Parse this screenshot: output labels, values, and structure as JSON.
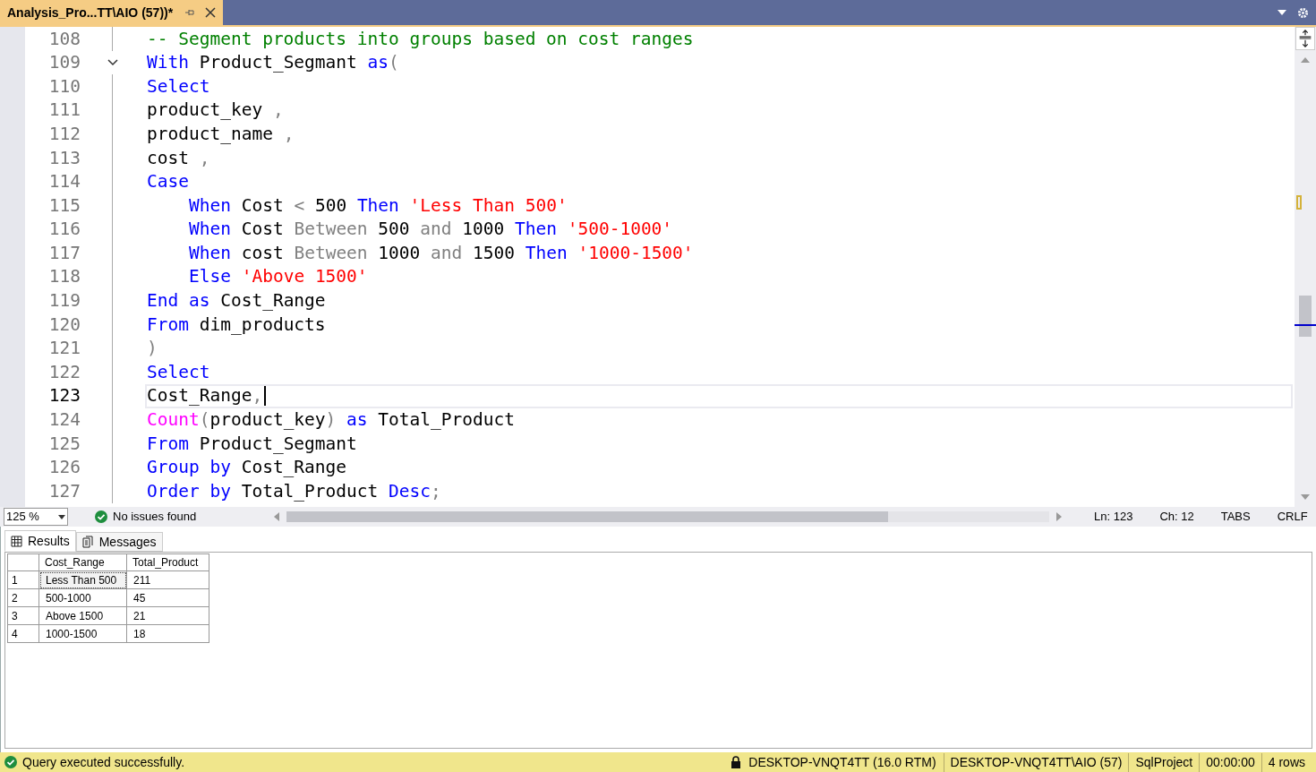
{
  "tab": {
    "title": "Analysis_Pro...TT\\AIO (57))*",
    "selected": true
  },
  "editor": {
    "lines": [
      {
        "number": "108",
        "current": false,
        "foldable": false,
        "indented": false,
        "tokens": [
          {
            "kind": "comment",
            "text": "-- Segment products into groups based on cost ranges"
          }
        ]
      },
      {
        "number": "109",
        "current": false,
        "foldable": true,
        "indented": false,
        "tokens": [
          {
            "kind": "keyword",
            "text": "With"
          },
          {
            "kind": "plain",
            "text": " Product_Segmant "
          },
          {
            "kind": "keyword",
            "text": "as"
          },
          {
            "kind": "gray",
            "text": "("
          }
        ]
      },
      {
        "number": "110",
        "current": false,
        "foldable": false,
        "indented": false,
        "tokens": [
          {
            "kind": "keyword",
            "text": "Select"
          }
        ]
      },
      {
        "number": "111",
        "current": false,
        "foldable": false,
        "indented": false,
        "tokens": [
          {
            "kind": "plain",
            "text": "product_key "
          },
          {
            "kind": "gray",
            "text": ","
          }
        ]
      },
      {
        "number": "112",
        "current": false,
        "foldable": false,
        "indented": false,
        "tokens": [
          {
            "kind": "plain",
            "text": "product_name "
          },
          {
            "kind": "gray",
            "text": ","
          }
        ]
      },
      {
        "number": "113",
        "current": false,
        "foldable": false,
        "indented": false,
        "tokens": [
          {
            "kind": "plain",
            "text": "cost "
          },
          {
            "kind": "gray",
            "text": ","
          }
        ]
      },
      {
        "number": "114",
        "current": false,
        "foldable": false,
        "indented": false,
        "tokens": [
          {
            "kind": "keyword",
            "text": "Case"
          }
        ]
      },
      {
        "number": "115",
        "current": false,
        "foldable": false,
        "indented": true,
        "tokens": [
          {
            "kind": "keyword",
            "text": "When"
          },
          {
            "kind": "plain",
            "text": " Cost "
          },
          {
            "kind": "gray",
            "text": "<"
          },
          {
            "kind": "plain",
            "text": " 500 "
          },
          {
            "kind": "keyword",
            "text": "Then "
          },
          {
            "kind": "string",
            "text": "'Less Than 500'"
          }
        ]
      },
      {
        "number": "116",
        "current": false,
        "foldable": false,
        "indented": true,
        "tokens": [
          {
            "kind": "keyword",
            "text": "When"
          },
          {
            "kind": "plain",
            "text": " Cost "
          },
          {
            "kind": "gray",
            "text": "Between"
          },
          {
            "kind": "plain",
            "text": " 500 "
          },
          {
            "kind": "gray",
            "text": "and"
          },
          {
            "kind": "plain",
            "text": " 1000 "
          },
          {
            "kind": "keyword",
            "text": "Then "
          },
          {
            "kind": "string",
            "text": "'500-1000'"
          }
        ]
      },
      {
        "number": "117",
        "current": false,
        "foldable": false,
        "indented": true,
        "tokens": [
          {
            "kind": "keyword",
            "text": "When"
          },
          {
            "kind": "plain",
            "text": " cost "
          },
          {
            "kind": "gray",
            "text": "Between"
          },
          {
            "kind": "plain",
            "text": " 1000 "
          },
          {
            "kind": "gray",
            "text": "and"
          },
          {
            "kind": "plain",
            "text": " 1500 "
          },
          {
            "kind": "keyword",
            "text": "Then "
          },
          {
            "kind": "string",
            "text": "'1000-1500'"
          }
        ]
      },
      {
        "number": "118",
        "current": false,
        "foldable": false,
        "indented": true,
        "tokens": [
          {
            "kind": "keyword",
            "text": "Else "
          },
          {
            "kind": "string",
            "text": "'Above 1500'"
          }
        ]
      },
      {
        "number": "119",
        "current": false,
        "foldable": false,
        "indented": false,
        "tokens": [
          {
            "kind": "keyword",
            "text": "End as"
          },
          {
            "kind": "plain",
            "text": " Cost_Range"
          }
        ]
      },
      {
        "number": "120",
        "current": false,
        "foldable": false,
        "indented": false,
        "tokens": [
          {
            "kind": "keyword",
            "text": "From"
          },
          {
            "kind": "plain",
            "text": " dim_products"
          }
        ]
      },
      {
        "number": "121",
        "current": false,
        "foldable": false,
        "indented": false,
        "tokens": [
          {
            "kind": "gray",
            "text": ")"
          }
        ]
      },
      {
        "number": "122",
        "current": false,
        "foldable": false,
        "indented": false,
        "tokens": [
          {
            "kind": "keyword",
            "text": "Select"
          }
        ]
      },
      {
        "number": "123",
        "current": true,
        "foldable": false,
        "indented": false,
        "tokens": [
          {
            "kind": "plain",
            "text": "Cost_Range"
          },
          {
            "kind": "gray",
            "text": ","
          }
        ]
      },
      {
        "number": "124",
        "current": false,
        "foldable": false,
        "indented": false,
        "tokens": [
          {
            "kind": "function",
            "text": "Count"
          },
          {
            "kind": "gray",
            "text": "("
          },
          {
            "kind": "plain",
            "text": "product_key"
          },
          {
            "kind": "gray",
            "text": ")"
          },
          {
            "kind": "keyword",
            "text": " as"
          },
          {
            "kind": "plain",
            "text": " Total_Product"
          }
        ]
      },
      {
        "number": "125",
        "current": false,
        "foldable": false,
        "indented": false,
        "tokens": [
          {
            "kind": "keyword",
            "text": "From"
          },
          {
            "kind": "plain",
            "text": " Product_Segmant"
          }
        ]
      },
      {
        "number": "126",
        "current": false,
        "foldable": false,
        "indented": false,
        "tokens": [
          {
            "kind": "keyword",
            "text": "Group by"
          },
          {
            "kind": "plain",
            "text": " Cost_Range"
          }
        ]
      },
      {
        "number": "127",
        "current": false,
        "foldable": false,
        "indented": false,
        "tokens": [
          {
            "kind": "keyword",
            "text": "Order by"
          },
          {
            "kind": "plain",
            "text": " Total_Product "
          },
          {
            "kind": "keyword",
            "text": "Desc"
          },
          {
            "kind": "gray",
            "text": ";"
          }
        ]
      }
    ]
  },
  "editor_status": {
    "zoom": "125 %",
    "issues": "No issues found",
    "line": "Ln: 123",
    "column": "Ch: 12",
    "indent": "TABS",
    "line_ending": "CRLF"
  },
  "result_tabs": [
    {
      "label": "Results",
      "selected": true
    },
    {
      "label": "Messages",
      "selected": false
    }
  ],
  "results": {
    "columns": [
      "Cost_Range",
      "Total_Product"
    ],
    "rows": [
      {
        "number": "1",
        "cells": [
          "Less Than 500",
          "211"
        ],
        "selected": true
      },
      {
        "number": "2",
        "cells": [
          "500-1000",
          "45"
        ],
        "selected": false
      },
      {
        "number": "3",
        "cells": [
          "Above 1500",
          "21"
        ],
        "selected": false
      },
      {
        "number": "4",
        "cells": [
          "1000-1500",
          "18"
        ],
        "selected": false
      }
    ]
  },
  "status_bar": {
    "message": "Query executed successfully.",
    "server": "DESKTOP-VNQT4TT (16.0 RTM)",
    "user": "DESKTOP-VNQT4TT\\AIO (57)",
    "database": "SqlProject",
    "elapsed": "00:00:00",
    "rows": "4 rows"
  }
}
